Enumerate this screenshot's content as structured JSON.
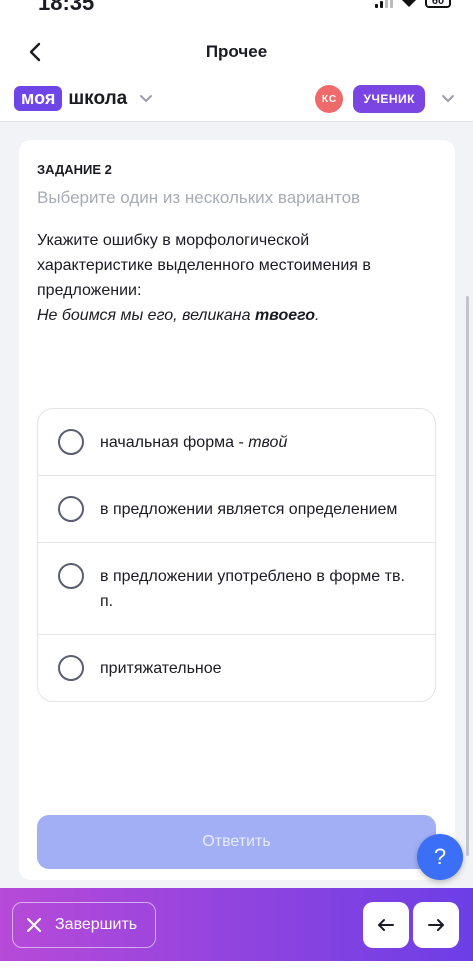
{
  "status": {
    "time": "18:35",
    "battery": "60"
  },
  "header": {
    "title": "Прочее"
  },
  "brand": {
    "part1": "моя",
    "part2": "школа"
  },
  "user": {
    "initials": "КС",
    "role": "УЧЕНИК"
  },
  "task": {
    "label": "ЗАДАНИЕ 2",
    "hint": "Выберите один из нескольких вариантов",
    "question": "Укажите ошибку в морфологической характеристике выделенного местоимения в предложении:",
    "sentence_start": "Не боимся мы его, великана ",
    "sentence_bold": "твоего",
    "sentence_end": "."
  },
  "options": [
    {
      "text": "начальная форма - ",
      "italic": "твой"
    },
    {
      "text": "в предложении является определением",
      "italic": ""
    },
    {
      "text": "в предложении употреблено в форме тв. п.",
      "italic": ""
    },
    {
      "text": "притяжательное",
      "italic": ""
    }
  ],
  "answer_button": "Ответить",
  "help_label": "?",
  "footer": {
    "finish_label": "Завершить"
  },
  "colors": {
    "brand": "#6e46e8",
    "answer_disabled": "#a3aff5",
    "help": "#3b6ff5",
    "avatar": "#ef6b6b"
  }
}
